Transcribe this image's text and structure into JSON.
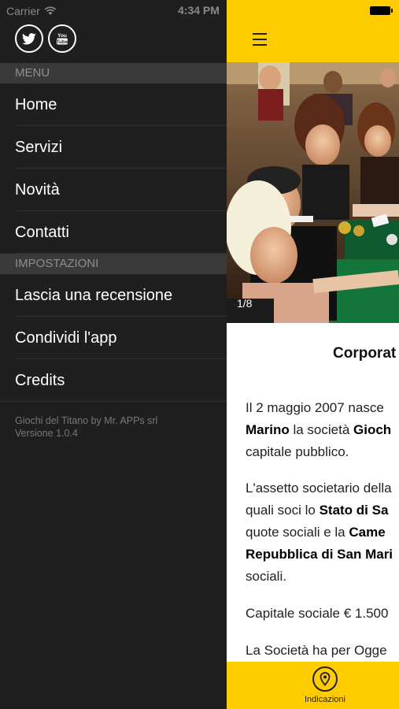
{
  "status_bar": {
    "carrier": "Carrier",
    "time": "4:34 PM"
  },
  "social": [
    {
      "name": "twitter-button",
      "icon": "twitter-icon"
    },
    {
      "name": "youtube-button",
      "icon": "youtube-icon",
      "text": "You\nTube"
    }
  ],
  "menu": {
    "header": "MENU",
    "items": [
      {
        "label": "Home"
      },
      {
        "label": "Servizi"
      },
      {
        "label": "Novità"
      },
      {
        "label": "Contatti"
      }
    ]
  },
  "settings": {
    "header": "IMPOSTAZIONI",
    "items": [
      {
        "label": "Lascia una recensione"
      },
      {
        "label": "Condividi l'app"
      },
      {
        "label": "Credits"
      }
    ]
  },
  "footer": {
    "line1": "Giochi del Titano by Mr. APPs srl",
    "line2": "Versione 1.0.4"
  },
  "gallery": {
    "counter": "1/8"
  },
  "article": {
    "title": "Corporat",
    "p1": {
      "l1": "Il 2 maggio 2007 nasce",
      "l2a": "Marino",
      "l2b": " la società ",
      "l2c": "Gioch",
      "l3": "capitale pubblico."
    },
    "p2": {
      "l1": "L'assetto societario della",
      "l2a": "quali soci lo ",
      "l2b": "Stato di Sa",
      "l3a": "quote sociali e la ",
      "l3b": "Came",
      "l4": "Repubblica di San Mari",
      "l5": "sociali."
    },
    "p3": "Capitale sociale € 1.500",
    "p4": "La Società ha per Ogge"
  },
  "tabbar": {
    "label": "Indicazioni",
    "icon": "map-pin-icon"
  },
  "colors": {
    "accent": "#ffcc00",
    "menu_bg": "#1f1f1f",
    "section_bg": "#3a3a3a"
  }
}
